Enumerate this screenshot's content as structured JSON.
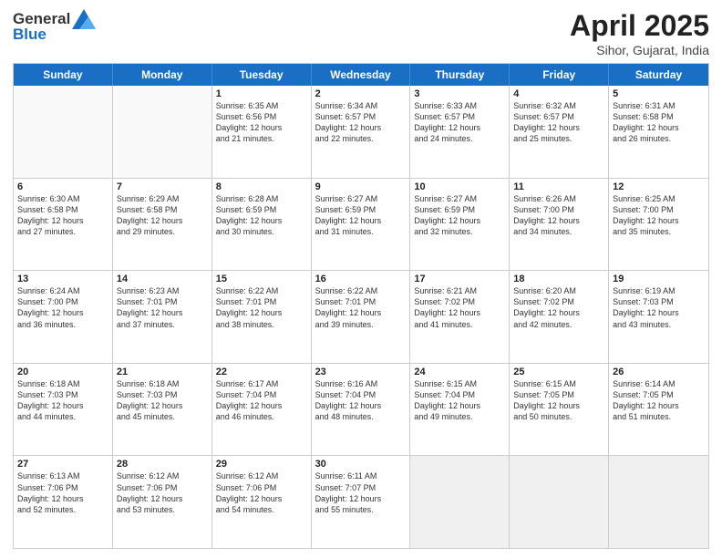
{
  "header": {
    "logo_line1": "General",
    "logo_line2": "Blue",
    "month_title": "April 2025",
    "subtitle": "Sihor, Gujarat, India"
  },
  "days_of_week": [
    "Sunday",
    "Monday",
    "Tuesday",
    "Wednesday",
    "Thursday",
    "Friday",
    "Saturday"
  ],
  "weeks": [
    [
      {
        "day": "",
        "empty": true
      },
      {
        "day": "",
        "empty": true
      },
      {
        "day": "1",
        "line1": "Sunrise: 6:35 AM",
        "line2": "Sunset: 6:56 PM",
        "line3": "Daylight: 12 hours",
        "line4": "and 21 minutes."
      },
      {
        "day": "2",
        "line1": "Sunrise: 6:34 AM",
        "line2": "Sunset: 6:57 PM",
        "line3": "Daylight: 12 hours",
        "line4": "and 22 minutes."
      },
      {
        "day": "3",
        "line1": "Sunrise: 6:33 AM",
        "line2": "Sunset: 6:57 PM",
        "line3": "Daylight: 12 hours",
        "line4": "and 24 minutes."
      },
      {
        "day": "4",
        "line1": "Sunrise: 6:32 AM",
        "line2": "Sunset: 6:57 PM",
        "line3": "Daylight: 12 hours",
        "line4": "and 25 minutes."
      },
      {
        "day": "5",
        "line1": "Sunrise: 6:31 AM",
        "line2": "Sunset: 6:58 PM",
        "line3": "Daylight: 12 hours",
        "line4": "and 26 minutes."
      }
    ],
    [
      {
        "day": "6",
        "line1": "Sunrise: 6:30 AM",
        "line2": "Sunset: 6:58 PM",
        "line3": "Daylight: 12 hours",
        "line4": "and 27 minutes."
      },
      {
        "day": "7",
        "line1": "Sunrise: 6:29 AM",
        "line2": "Sunset: 6:58 PM",
        "line3": "Daylight: 12 hours",
        "line4": "and 29 minutes."
      },
      {
        "day": "8",
        "line1": "Sunrise: 6:28 AM",
        "line2": "Sunset: 6:59 PM",
        "line3": "Daylight: 12 hours",
        "line4": "and 30 minutes."
      },
      {
        "day": "9",
        "line1": "Sunrise: 6:27 AM",
        "line2": "Sunset: 6:59 PM",
        "line3": "Daylight: 12 hours",
        "line4": "and 31 minutes."
      },
      {
        "day": "10",
        "line1": "Sunrise: 6:27 AM",
        "line2": "Sunset: 6:59 PM",
        "line3": "Daylight: 12 hours",
        "line4": "and 32 minutes."
      },
      {
        "day": "11",
        "line1": "Sunrise: 6:26 AM",
        "line2": "Sunset: 7:00 PM",
        "line3": "Daylight: 12 hours",
        "line4": "and 34 minutes."
      },
      {
        "day": "12",
        "line1": "Sunrise: 6:25 AM",
        "line2": "Sunset: 7:00 PM",
        "line3": "Daylight: 12 hours",
        "line4": "and 35 minutes."
      }
    ],
    [
      {
        "day": "13",
        "line1": "Sunrise: 6:24 AM",
        "line2": "Sunset: 7:00 PM",
        "line3": "Daylight: 12 hours",
        "line4": "and 36 minutes."
      },
      {
        "day": "14",
        "line1": "Sunrise: 6:23 AM",
        "line2": "Sunset: 7:01 PM",
        "line3": "Daylight: 12 hours",
        "line4": "and 37 minutes."
      },
      {
        "day": "15",
        "line1": "Sunrise: 6:22 AM",
        "line2": "Sunset: 7:01 PM",
        "line3": "Daylight: 12 hours",
        "line4": "and 38 minutes."
      },
      {
        "day": "16",
        "line1": "Sunrise: 6:22 AM",
        "line2": "Sunset: 7:01 PM",
        "line3": "Daylight: 12 hours",
        "line4": "and 39 minutes."
      },
      {
        "day": "17",
        "line1": "Sunrise: 6:21 AM",
        "line2": "Sunset: 7:02 PM",
        "line3": "Daylight: 12 hours",
        "line4": "and 41 minutes."
      },
      {
        "day": "18",
        "line1": "Sunrise: 6:20 AM",
        "line2": "Sunset: 7:02 PM",
        "line3": "Daylight: 12 hours",
        "line4": "and 42 minutes."
      },
      {
        "day": "19",
        "line1": "Sunrise: 6:19 AM",
        "line2": "Sunset: 7:03 PM",
        "line3": "Daylight: 12 hours",
        "line4": "and 43 minutes."
      }
    ],
    [
      {
        "day": "20",
        "line1": "Sunrise: 6:18 AM",
        "line2": "Sunset: 7:03 PM",
        "line3": "Daylight: 12 hours",
        "line4": "and 44 minutes."
      },
      {
        "day": "21",
        "line1": "Sunrise: 6:18 AM",
        "line2": "Sunset: 7:03 PM",
        "line3": "Daylight: 12 hours",
        "line4": "and 45 minutes."
      },
      {
        "day": "22",
        "line1": "Sunrise: 6:17 AM",
        "line2": "Sunset: 7:04 PM",
        "line3": "Daylight: 12 hours",
        "line4": "and 46 minutes."
      },
      {
        "day": "23",
        "line1": "Sunrise: 6:16 AM",
        "line2": "Sunset: 7:04 PM",
        "line3": "Daylight: 12 hours",
        "line4": "and 48 minutes."
      },
      {
        "day": "24",
        "line1": "Sunrise: 6:15 AM",
        "line2": "Sunset: 7:04 PM",
        "line3": "Daylight: 12 hours",
        "line4": "and 49 minutes."
      },
      {
        "day": "25",
        "line1": "Sunrise: 6:15 AM",
        "line2": "Sunset: 7:05 PM",
        "line3": "Daylight: 12 hours",
        "line4": "and 50 minutes."
      },
      {
        "day": "26",
        "line1": "Sunrise: 6:14 AM",
        "line2": "Sunset: 7:05 PM",
        "line3": "Daylight: 12 hours",
        "line4": "and 51 minutes."
      }
    ],
    [
      {
        "day": "27",
        "line1": "Sunrise: 6:13 AM",
        "line2": "Sunset: 7:06 PM",
        "line3": "Daylight: 12 hours",
        "line4": "and 52 minutes."
      },
      {
        "day": "28",
        "line1": "Sunrise: 6:12 AM",
        "line2": "Sunset: 7:06 PM",
        "line3": "Daylight: 12 hours",
        "line4": "and 53 minutes."
      },
      {
        "day": "29",
        "line1": "Sunrise: 6:12 AM",
        "line2": "Sunset: 7:06 PM",
        "line3": "Daylight: 12 hours",
        "line4": "and 54 minutes."
      },
      {
        "day": "30",
        "line1": "Sunrise: 6:11 AM",
        "line2": "Sunset: 7:07 PM",
        "line3": "Daylight: 12 hours",
        "line4": "and 55 minutes."
      },
      {
        "day": "",
        "empty": true
      },
      {
        "day": "",
        "empty": true
      },
      {
        "day": "",
        "empty": true
      }
    ]
  ]
}
